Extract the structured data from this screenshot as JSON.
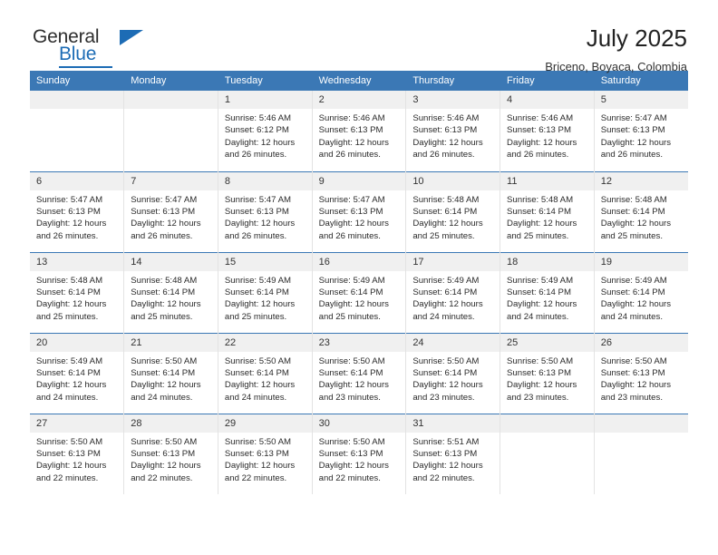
{
  "brand": {
    "name_part1": "General",
    "name_part2": "Blue"
  },
  "header": {
    "title": "July 2025",
    "subtitle": "Briceno, Boyaca, Colombia",
    "accent_color": "#3b78b5",
    "daynum_band_color": "#f0f0f0"
  },
  "weekdays": [
    "Sunday",
    "Monday",
    "Tuesday",
    "Wednesday",
    "Thursday",
    "Friday",
    "Saturday"
  ],
  "labels": {
    "sunrise": "Sunrise:",
    "sunset": "Sunset:",
    "daylight": "Daylight:"
  },
  "weeks": [
    [
      {
        "day": "",
        "empty": true
      },
      {
        "day": "",
        "empty": true
      },
      {
        "day": "1",
        "sunrise": "Sunrise: 5:46 AM",
        "sunset": "Sunset: 6:12 PM",
        "daylight1": "Daylight: 12 hours",
        "daylight2": "and 26 minutes."
      },
      {
        "day": "2",
        "sunrise": "Sunrise: 5:46 AM",
        "sunset": "Sunset: 6:13 PM",
        "daylight1": "Daylight: 12 hours",
        "daylight2": "and 26 minutes."
      },
      {
        "day": "3",
        "sunrise": "Sunrise: 5:46 AM",
        "sunset": "Sunset: 6:13 PM",
        "daylight1": "Daylight: 12 hours",
        "daylight2": "and 26 minutes."
      },
      {
        "day": "4",
        "sunrise": "Sunrise: 5:46 AM",
        "sunset": "Sunset: 6:13 PM",
        "daylight1": "Daylight: 12 hours",
        "daylight2": "and 26 minutes."
      },
      {
        "day": "5",
        "sunrise": "Sunrise: 5:47 AM",
        "sunset": "Sunset: 6:13 PM",
        "daylight1": "Daylight: 12 hours",
        "daylight2": "and 26 minutes."
      }
    ],
    [
      {
        "day": "6",
        "sunrise": "Sunrise: 5:47 AM",
        "sunset": "Sunset: 6:13 PM",
        "daylight1": "Daylight: 12 hours",
        "daylight2": "and 26 minutes."
      },
      {
        "day": "7",
        "sunrise": "Sunrise: 5:47 AM",
        "sunset": "Sunset: 6:13 PM",
        "daylight1": "Daylight: 12 hours",
        "daylight2": "and 26 minutes."
      },
      {
        "day": "8",
        "sunrise": "Sunrise: 5:47 AM",
        "sunset": "Sunset: 6:13 PM",
        "daylight1": "Daylight: 12 hours",
        "daylight2": "and 26 minutes."
      },
      {
        "day": "9",
        "sunrise": "Sunrise: 5:47 AM",
        "sunset": "Sunset: 6:13 PM",
        "daylight1": "Daylight: 12 hours",
        "daylight2": "and 26 minutes."
      },
      {
        "day": "10",
        "sunrise": "Sunrise: 5:48 AM",
        "sunset": "Sunset: 6:14 PM",
        "daylight1": "Daylight: 12 hours",
        "daylight2": "and 25 minutes."
      },
      {
        "day": "11",
        "sunrise": "Sunrise: 5:48 AM",
        "sunset": "Sunset: 6:14 PM",
        "daylight1": "Daylight: 12 hours",
        "daylight2": "and 25 minutes."
      },
      {
        "day": "12",
        "sunrise": "Sunrise: 5:48 AM",
        "sunset": "Sunset: 6:14 PM",
        "daylight1": "Daylight: 12 hours",
        "daylight2": "and 25 minutes."
      }
    ],
    [
      {
        "day": "13",
        "sunrise": "Sunrise: 5:48 AM",
        "sunset": "Sunset: 6:14 PM",
        "daylight1": "Daylight: 12 hours",
        "daylight2": "and 25 minutes."
      },
      {
        "day": "14",
        "sunrise": "Sunrise: 5:48 AM",
        "sunset": "Sunset: 6:14 PM",
        "daylight1": "Daylight: 12 hours",
        "daylight2": "and 25 minutes."
      },
      {
        "day": "15",
        "sunrise": "Sunrise: 5:49 AM",
        "sunset": "Sunset: 6:14 PM",
        "daylight1": "Daylight: 12 hours",
        "daylight2": "and 25 minutes."
      },
      {
        "day": "16",
        "sunrise": "Sunrise: 5:49 AM",
        "sunset": "Sunset: 6:14 PM",
        "daylight1": "Daylight: 12 hours",
        "daylight2": "and 25 minutes."
      },
      {
        "day": "17",
        "sunrise": "Sunrise: 5:49 AM",
        "sunset": "Sunset: 6:14 PM",
        "daylight1": "Daylight: 12 hours",
        "daylight2": "and 24 minutes."
      },
      {
        "day": "18",
        "sunrise": "Sunrise: 5:49 AM",
        "sunset": "Sunset: 6:14 PM",
        "daylight1": "Daylight: 12 hours",
        "daylight2": "and 24 minutes."
      },
      {
        "day": "19",
        "sunrise": "Sunrise: 5:49 AM",
        "sunset": "Sunset: 6:14 PM",
        "daylight1": "Daylight: 12 hours",
        "daylight2": "and 24 minutes."
      }
    ],
    [
      {
        "day": "20",
        "sunrise": "Sunrise: 5:49 AM",
        "sunset": "Sunset: 6:14 PM",
        "daylight1": "Daylight: 12 hours",
        "daylight2": "and 24 minutes."
      },
      {
        "day": "21",
        "sunrise": "Sunrise: 5:50 AM",
        "sunset": "Sunset: 6:14 PM",
        "daylight1": "Daylight: 12 hours",
        "daylight2": "and 24 minutes."
      },
      {
        "day": "22",
        "sunrise": "Sunrise: 5:50 AM",
        "sunset": "Sunset: 6:14 PM",
        "daylight1": "Daylight: 12 hours",
        "daylight2": "and 24 minutes."
      },
      {
        "day": "23",
        "sunrise": "Sunrise: 5:50 AM",
        "sunset": "Sunset: 6:14 PM",
        "daylight1": "Daylight: 12 hours",
        "daylight2": "and 23 minutes."
      },
      {
        "day": "24",
        "sunrise": "Sunrise: 5:50 AM",
        "sunset": "Sunset: 6:14 PM",
        "daylight1": "Daylight: 12 hours",
        "daylight2": "and 23 minutes."
      },
      {
        "day": "25",
        "sunrise": "Sunrise: 5:50 AM",
        "sunset": "Sunset: 6:13 PM",
        "daylight1": "Daylight: 12 hours",
        "daylight2": "and 23 minutes."
      },
      {
        "day": "26",
        "sunrise": "Sunrise: 5:50 AM",
        "sunset": "Sunset: 6:13 PM",
        "daylight1": "Daylight: 12 hours",
        "daylight2": "and 23 minutes."
      }
    ],
    [
      {
        "day": "27",
        "sunrise": "Sunrise: 5:50 AM",
        "sunset": "Sunset: 6:13 PM",
        "daylight1": "Daylight: 12 hours",
        "daylight2": "and 22 minutes."
      },
      {
        "day": "28",
        "sunrise": "Sunrise: 5:50 AM",
        "sunset": "Sunset: 6:13 PM",
        "daylight1": "Daylight: 12 hours",
        "daylight2": "and 22 minutes."
      },
      {
        "day": "29",
        "sunrise": "Sunrise: 5:50 AM",
        "sunset": "Sunset: 6:13 PM",
        "daylight1": "Daylight: 12 hours",
        "daylight2": "and 22 minutes."
      },
      {
        "day": "30",
        "sunrise": "Sunrise: 5:50 AM",
        "sunset": "Sunset: 6:13 PM",
        "daylight1": "Daylight: 12 hours",
        "daylight2": "and 22 minutes."
      },
      {
        "day": "31",
        "sunrise": "Sunrise: 5:51 AM",
        "sunset": "Sunset: 6:13 PM",
        "daylight1": "Daylight: 12 hours",
        "daylight2": "and 22 minutes."
      },
      {
        "day": "",
        "empty": true
      },
      {
        "day": "",
        "empty": true
      }
    ]
  ]
}
